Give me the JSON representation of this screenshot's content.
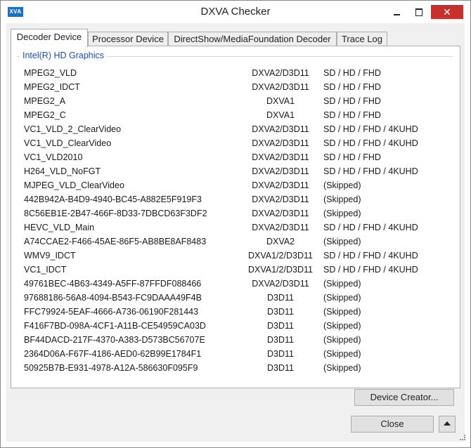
{
  "window": {
    "title": "DXVA Checker",
    "icon_text": "XVA",
    "controls": [
      "minimize",
      "maximize",
      "close"
    ]
  },
  "tabs": [
    {
      "label": "Decoder Device",
      "active": true
    },
    {
      "label": "Processor Device",
      "active": false
    },
    {
      "label": "DirectShow/MediaFoundation Decoder",
      "active": false
    },
    {
      "label": "Trace Log",
      "active": false
    }
  ],
  "group": {
    "label": "Intel(R) HD Graphics"
  },
  "decoders": [
    {
      "name": "MPEG2_VLD",
      "api": "DXVA2/D3D11",
      "res": "SD / HD / FHD"
    },
    {
      "name": "MPEG2_IDCT",
      "api": "DXVA2/D3D11",
      "res": "SD / HD / FHD"
    },
    {
      "name": "MPEG2_A",
      "api": "DXVA1",
      "res": "SD / HD / FHD"
    },
    {
      "name": "MPEG2_C",
      "api": "DXVA1",
      "res": "SD / HD / FHD"
    },
    {
      "name": "VC1_VLD_2_ClearVideo",
      "api": "DXVA2/D3D11",
      "res": "SD / HD / FHD / 4KUHD"
    },
    {
      "name": "VC1_VLD_ClearVideo",
      "api": "DXVA2/D3D11",
      "res": "SD / HD / FHD / 4KUHD"
    },
    {
      "name": "VC1_VLD2010",
      "api": "DXVA2/D3D11",
      "res": "SD / HD / FHD"
    },
    {
      "name": "H264_VLD_NoFGT",
      "api": "DXVA2/D3D11",
      "res": "SD / HD / FHD / 4KUHD"
    },
    {
      "name": "MJPEG_VLD_ClearVideo",
      "api": "DXVA2/D3D11",
      "res": "(Skipped)"
    },
    {
      "name": "442B942A-B4D9-4940-BC45-A882E5F919F3",
      "api": "DXVA2/D3D11",
      "res": "(Skipped)"
    },
    {
      "name": "8C56EB1E-2B47-466F-8D33-7DBCD63F3DF2",
      "api": "DXVA2/D3D11",
      "res": "(Skipped)"
    },
    {
      "name": "HEVC_VLD_Main",
      "api": "DXVA2/D3D11",
      "res": "SD / HD / FHD / 4KUHD"
    },
    {
      "name": "A74CCAE2-F466-45AE-86F5-AB8BE8AF8483",
      "api": "DXVA2",
      "res": "(Skipped)"
    },
    {
      "name": "WMV9_IDCT",
      "api": "DXVA1/2/D3D11",
      "res": "SD / HD / FHD / 4KUHD"
    },
    {
      "name": "VC1_IDCT",
      "api": "DXVA1/2/D3D11",
      "res": "SD / HD / FHD / 4KUHD"
    },
    {
      "name": "49761BEC-4B63-4349-A5FF-87FFDF088466",
      "api": "DXVA2/D3D11",
      "res": "(Skipped)"
    },
    {
      "name": "97688186-56A8-4094-B543-FC9DAAA49F4B",
      "api": "D3D11",
      "res": "(Skipped)"
    },
    {
      "name": "FFC79924-5EAF-4666-A736-06190F281443",
      "api": "D3D11",
      "res": "(Skipped)"
    },
    {
      "name": "F416F7BD-098A-4CF1-A11B-CE54959CA03D",
      "api": "D3D11",
      "res": "(Skipped)"
    },
    {
      "name": "BF44DACD-217F-4370-A383-D573BC56707E",
      "api": "D3D11",
      "res": "(Skipped)"
    },
    {
      "name": "2364D06A-F67F-4186-AED0-62B99E1784F1",
      "api": "D3D11",
      "res": "(Skipped)"
    },
    {
      "name": "50925B7B-E931-4978-A12A-586630F095F9",
      "api": "D3D11",
      "res": "(Skipped)"
    }
  ],
  "buttons": {
    "device_creator": "Device Creator...",
    "close": "Close"
  }
}
